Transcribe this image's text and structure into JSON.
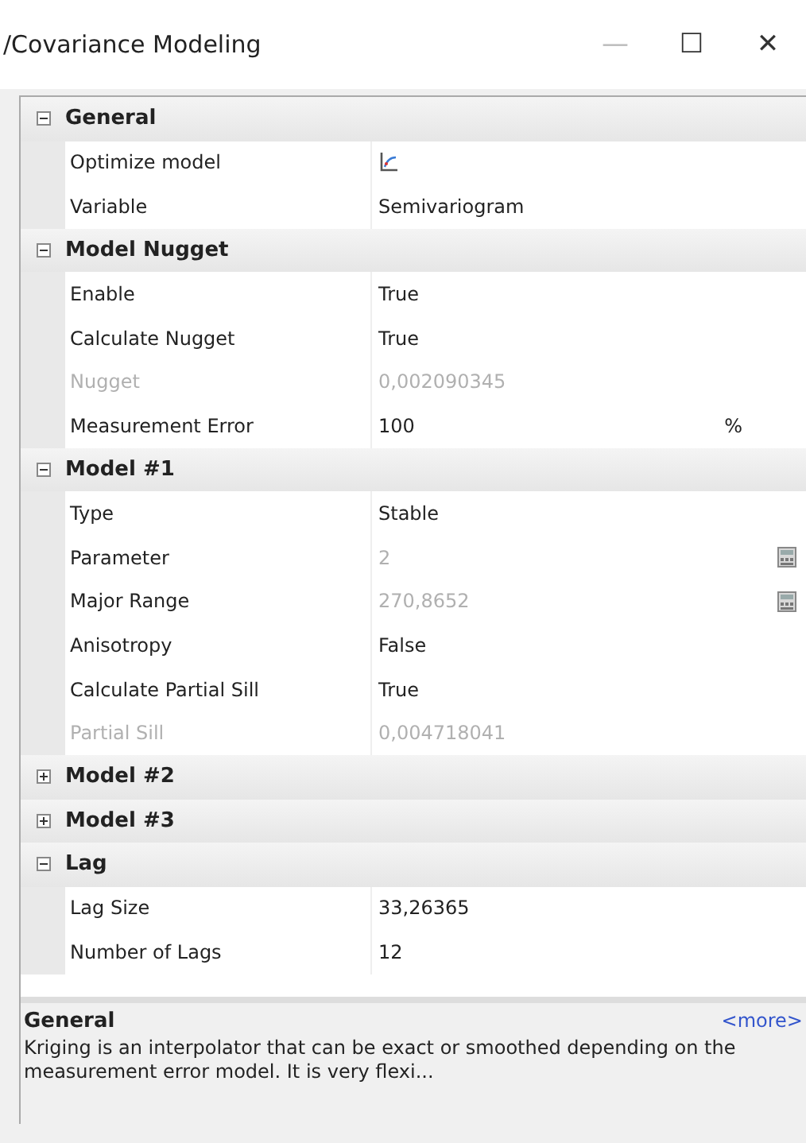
{
  "window": {
    "title": "/Covariance Modeling",
    "controls": [
      "—",
      "☐",
      "✕"
    ]
  },
  "categories": [
    {
      "label": "General",
      "expanded": true,
      "properties": [
        {
          "name": "Optimize model",
          "kind": "icon",
          "disabled": false
        },
        {
          "name": "Variable",
          "value": "Semivariogram",
          "kind": "text",
          "disabled": false
        }
      ]
    },
    {
      "label": "Model Nugget",
      "expanded": true,
      "properties": [
        {
          "name": "Enable",
          "value": "True",
          "kind": "text",
          "disabled": false
        },
        {
          "name": "Calculate Nugget",
          "value": "True",
          "kind": "text",
          "disabled": false
        },
        {
          "name": "Nugget",
          "value": "0,002090345",
          "kind": "text",
          "disabled": true
        },
        {
          "name": "Measurement Error",
          "value": "100",
          "unit": "%",
          "kind": "unit",
          "disabled": false
        }
      ]
    },
    {
      "label": "Model #1",
      "expanded": true,
      "properties": [
        {
          "name": "Type",
          "value": "Stable",
          "kind": "text",
          "disabled": false
        },
        {
          "name": "Parameter",
          "value": "2",
          "kind": "button",
          "disabled": false,
          "value_greyed": true
        },
        {
          "name": "Major Range",
          "value": "270,8652",
          "kind": "button",
          "disabled": false,
          "value_greyed": true
        },
        {
          "name": "Anisotropy",
          "value": "False",
          "kind": "text",
          "disabled": false
        },
        {
          "name": "Calculate Partial Sill",
          "value": "True",
          "kind": "text",
          "disabled": false
        },
        {
          "name": "Partial Sill",
          "value": "0,004718041",
          "kind": "text",
          "disabled": true
        }
      ]
    },
    {
      "label": "Model #2",
      "expanded": false
    },
    {
      "label": "Model #3",
      "expanded": false
    },
    {
      "label": "Lag",
      "expanded": true,
      "properties": [
        {
          "name": "Lag Size",
          "value": "33,26365",
          "kind": "text",
          "disabled": false
        },
        {
          "name": "Number of Lags",
          "value": "12",
          "kind": "text",
          "disabled": false
        }
      ]
    }
  ],
  "description": {
    "title": "General",
    "more_link": "<more>",
    "text": "Kriging is an interpolator that can be exact or smoothed depending on the measurement error model. It is very flexi..."
  }
}
